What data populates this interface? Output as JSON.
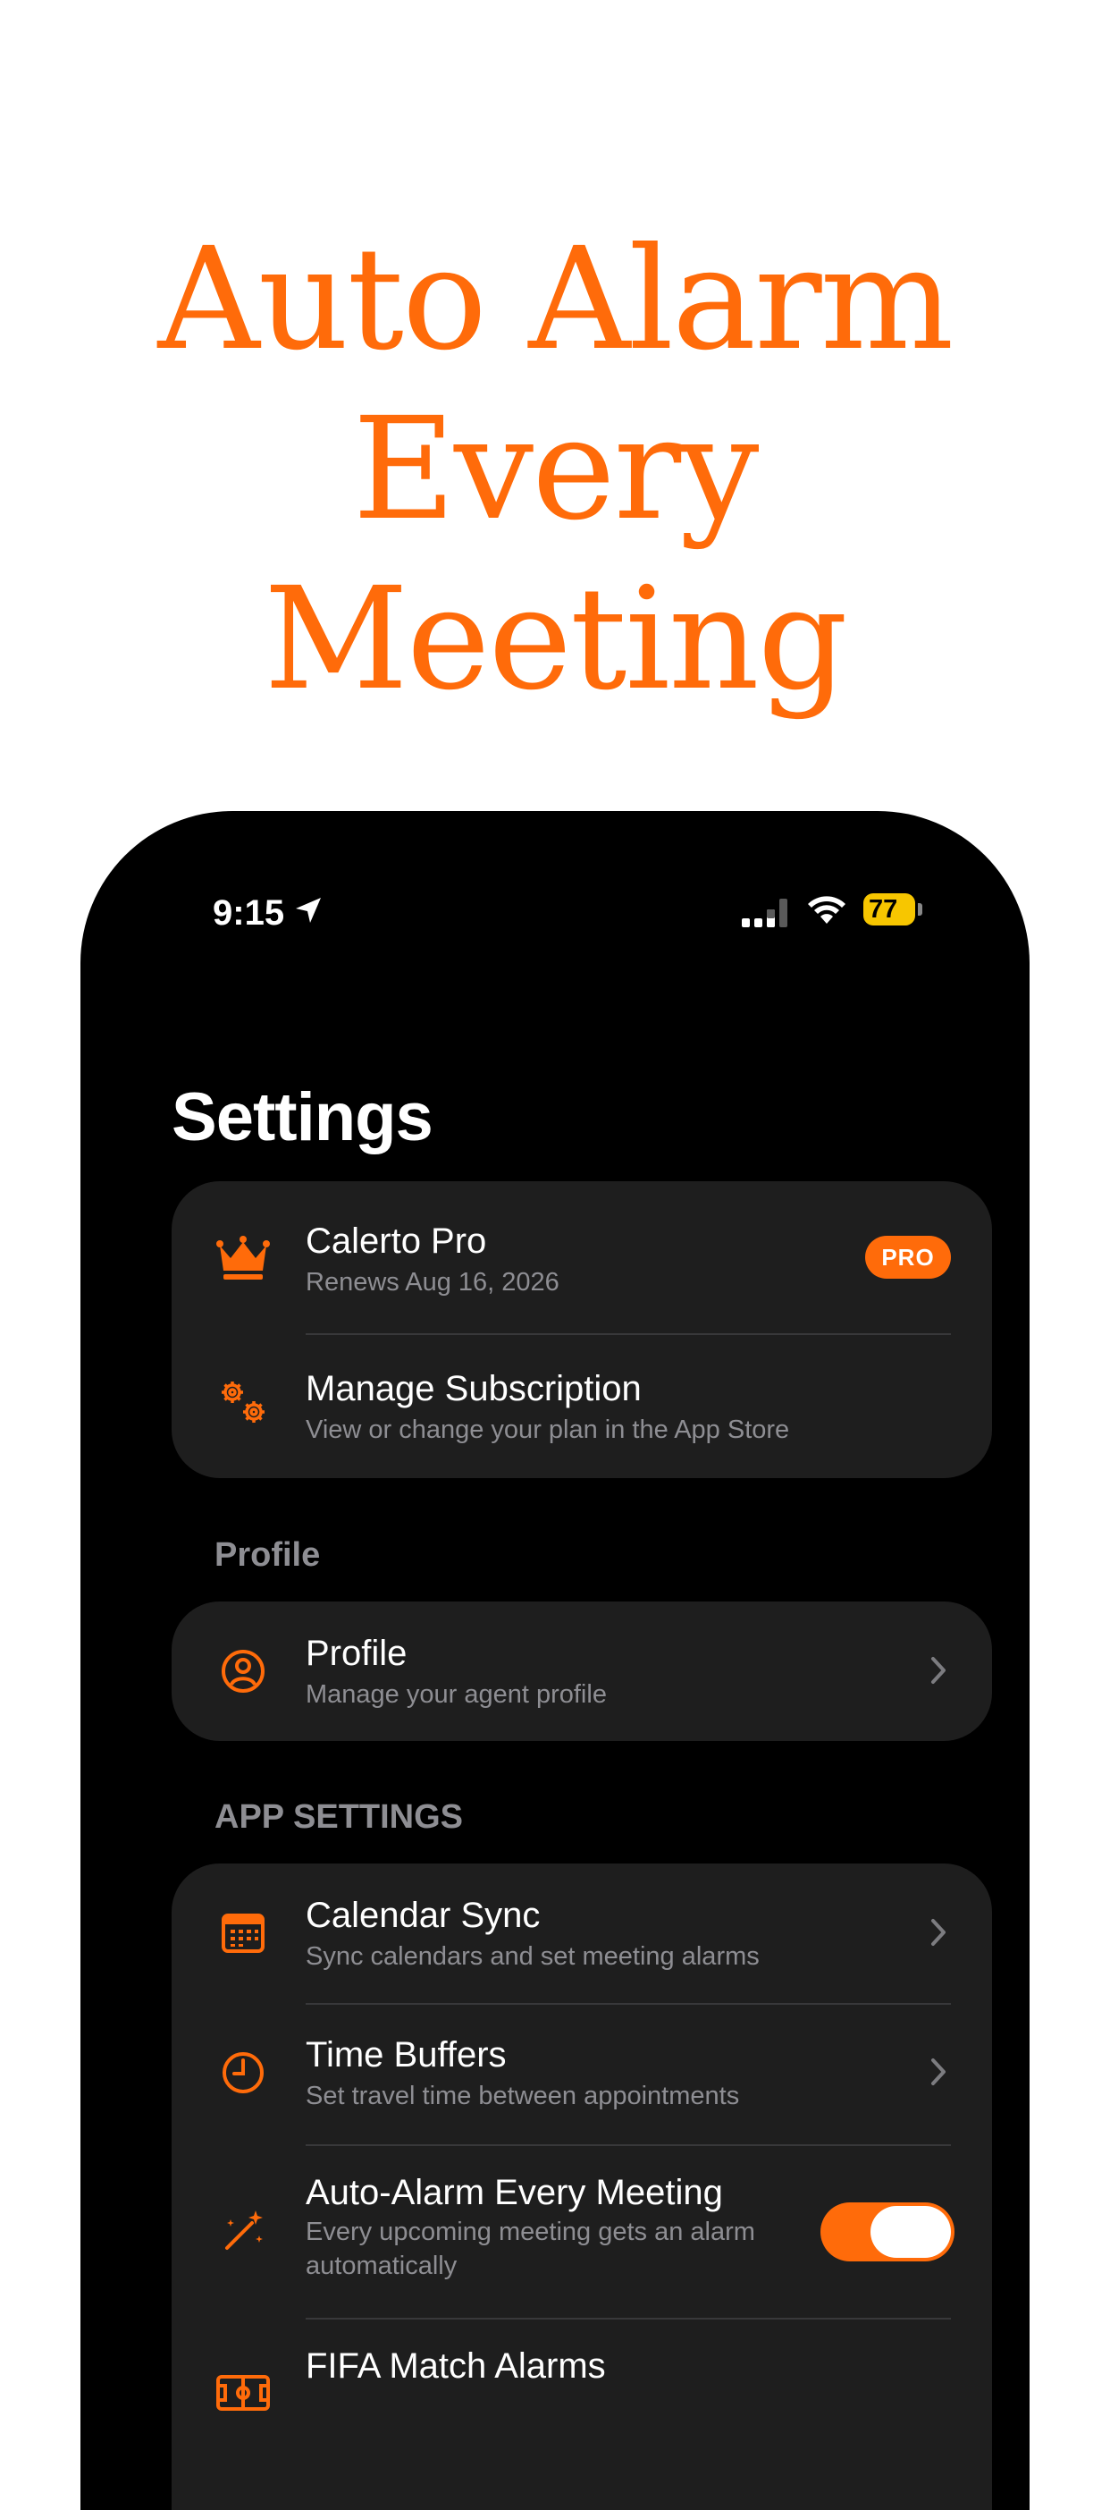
{
  "headline": [
    "Auto Alarm",
    "Every",
    "Meeting"
  ],
  "status_bar": {
    "time": "9:15",
    "battery": "77"
  },
  "colors": {
    "accent": "#ff6b0a",
    "card": "#1e1e1e",
    "secondary_text": "#8e8e93"
  },
  "page_title": "Settings",
  "subscription": {
    "pro": {
      "title": "Calerto Pro",
      "subtitle": "Renews Aug 16, 2026",
      "badge": "PRO",
      "icon": "crown-icon"
    },
    "manage": {
      "title": "Manage Subscription",
      "subtitle": "View or change your plan in the App Store",
      "icon": "gears-icon"
    }
  },
  "profile_section": {
    "header": "Profile",
    "items": [
      {
        "title": "Profile",
        "subtitle": "Manage your agent profile",
        "icon": "person-circle-icon"
      }
    ]
  },
  "app_settings": {
    "header": "APP SETTINGS",
    "items": [
      {
        "title": "Calendar Sync",
        "subtitle": "Sync calendars and set meeting alarms",
        "icon": "calendar-icon"
      },
      {
        "title": "Time Buffers",
        "subtitle": "Set travel time between appointments",
        "icon": "clock-icon"
      },
      {
        "title": "Auto-Alarm Every Meeting",
        "subtitle": "Every upcoming meeting gets an alarm automatically",
        "icon": "magic-wand-icon",
        "toggle_on": true
      },
      {
        "title": "FIFA Match Alarms",
        "subtitle": "",
        "icon": "soccer-field-icon"
      }
    ]
  }
}
